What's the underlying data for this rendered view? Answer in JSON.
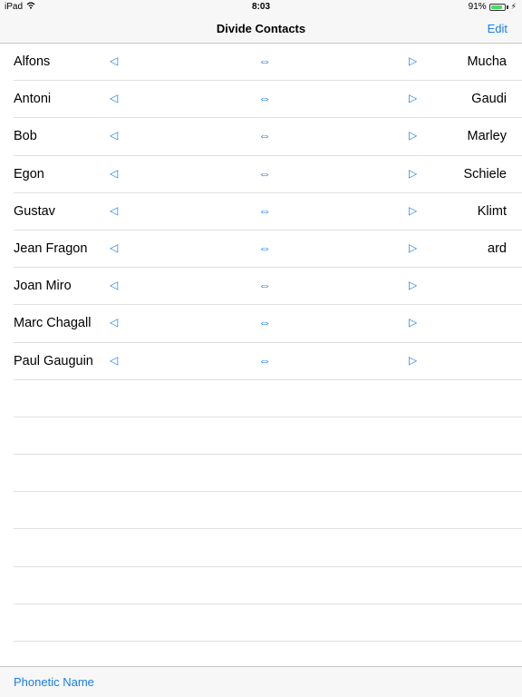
{
  "status_bar": {
    "device": "iPad",
    "time": "8:03",
    "battery_percent": "91%",
    "battery_level": 0.91,
    "battery_color": "#4cd964"
  },
  "nav": {
    "title": "Divide Contacts",
    "edit_label": "Edit"
  },
  "glyphs": {
    "left": "◁",
    "swap": "⇔",
    "right": "▷"
  },
  "accent_color": "#1a7de9",
  "contacts": [
    {
      "first": "Alfons",
      "last": "Mucha"
    },
    {
      "first": "Antoni",
      "last": "Gaudi"
    },
    {
      "first": "Bob",
      "last": "Marley"
    },
    {
      "first": "Egon",
      "last": "Schiele"
    },
    {
      "first": "Gustav",
      "last": "Klimt"
    },
    {
      "first": "Jean Fragon",
      "last": "ard"
    },
    {
      "first": "Joan Miro",
      "last": ""
    },
    {
      "first": "Marc Chagall",
      "last": ""
    },
    {
      "first": "Paul Gauguin",
      "last": ""
    }
  ],
  "toolbar": {
    "phonetic_label": "Phonetic Name"
  }
}
